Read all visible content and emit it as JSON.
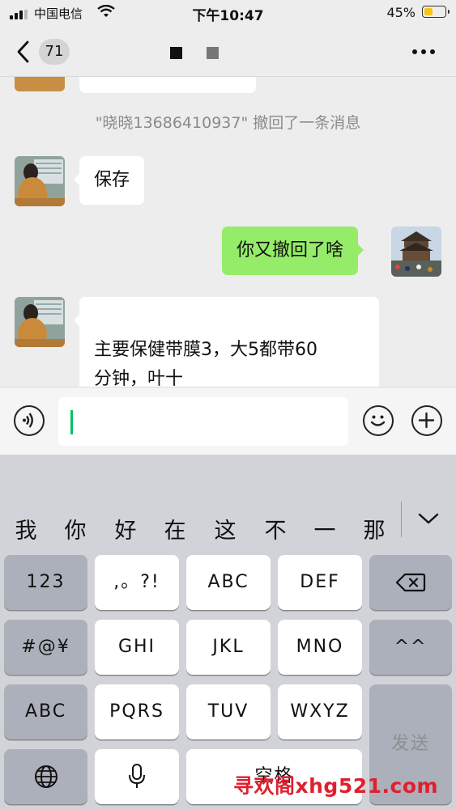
{
  "status_bar": {
    "carrier": "中国电信",
    "time": "下午10:47",
    "battery": "45%",
    "battery_level": 0.45,
    "battery_color": "#f5c518"
  },
  "nav": {
    "back_icon": "chevron-left-icon",
    "unread_count": "71",
    "more_icon": "more-dots-icon"
  },
  "chat": {
    "system_note": "\"晓晓13686410937\" 撤回了一条消息",
    "messages": [
      {
        "side": "in",
        "text": "保存"
      },
      {
        "side": "out",
        "text": "你又撤回了啥"
      },
      {
        "side": "in",
        "text": "主要保健带膜3，大5都带60\n分钟，叶十"
      }
    ],
    "outgoing_color": "#95ec69"
  },
  "input_bar": {
    "voice_icon": "voice-icon",
    "emoji_icon": "emoji-icon",
    "add_icon": "plus-icon",
    "accent_color": "#07c160"
  },
  "keyboard": {
    "candidates": [
      "我",
      "你",
      "好",
      "在",
      "这",
      "不",
      "一",
      "那"
    ],
    "collapse_icon": "chevron-down-icon",
    "row1": [
      "123",
      ",。?!",
      "ABC",
      "DEF"
    ],
    "backspace_icon": "backspace-icon",
    "row2": [
      "#@¥",
      "GHI",
      "JKL",
      "MNO",
      "^^"
    ],
    "row3": [
      "ABC",
      "PQRS",
      "TUV",
      "WXYZ"
    ],
    "send_label": "发送",
    "globe_icon": "globe-icon",
    "mic_icon": "microphone-icon",
    "space_label": "空格"
  },
  "watermark": "寻欢阁xhg521.com"
}
